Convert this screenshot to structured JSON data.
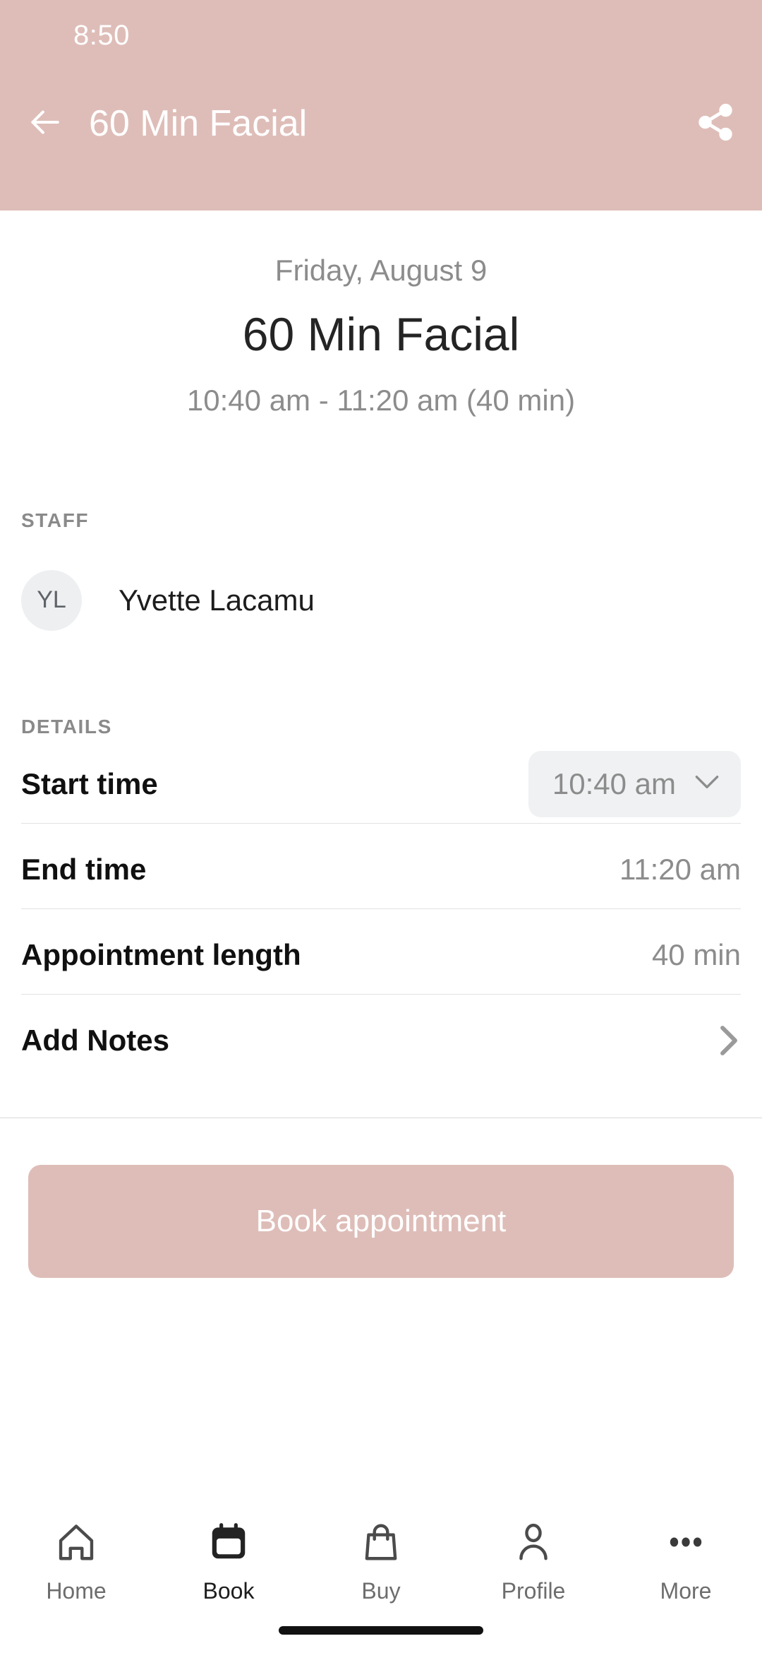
{
  "theme": {
    "accent": "#debdb8",
    "text_dark": "#1d1d1d",
    "text_muted": "#8c8c8c",
    "divider": "#e2e2e2",
    "pill_bg": "#eff1f2"
  },
  "status_bar": {
    "time": "8:50"
  },
  "appbar": {
    "title": "60 Min Facial",
    "back_icon": "arrow-left-icon",
    "share_icon": "share-icon"
  },
  "hero": {
    "date": "Friday, August 9",
    "title": "60 Min Facial",
    "time_range": "10:40 am - 11:20 am (40 min)"
  },
  "staff": {
    "section_label": "STAFF",
    "avatar_initials": "YL",
    "name": "Yvette Lacamu"
  },
  "details": {
    "section_label": "DETAILS",
    "rows": [
      {
        "label": "Start time",
        "value": "10:40 am",
        "type": "dropdown",
        "icon": "chevron-down-icon"
      },
      {
        "label": "End time",
        "value": "11:20 am",
        "type": "text"
      },
      {
        "label": "Appointment length",
        "value": "40 min",
        "type": "text"
      },
      {
        "label": "Add Notes",
        "value": "",
        "type": "navigate",
        "icon": "chevron-right-icon"
      }
    ]
  },
  "cta": {
    "label": "Book appointment"
  },
  "bottom_nav": {
    "items": [
      {
        "label": "Home",
        "icon": "home-icon",
        "active": false
      },
      {
        "label": "Book",
        "icon": "calendar-icon",
        "active": true
      },
      {
        "label": "Buy",
        "icon": "shopping-bag-icon",
        "active": false
      },
      {
        "label": "Profile",
        "icon": "person-icon",
        "active": false
      },
      {
        "label": "More",
        "icon": "three-dots-icon",
        "active": false
      }
    ]
  }
}
